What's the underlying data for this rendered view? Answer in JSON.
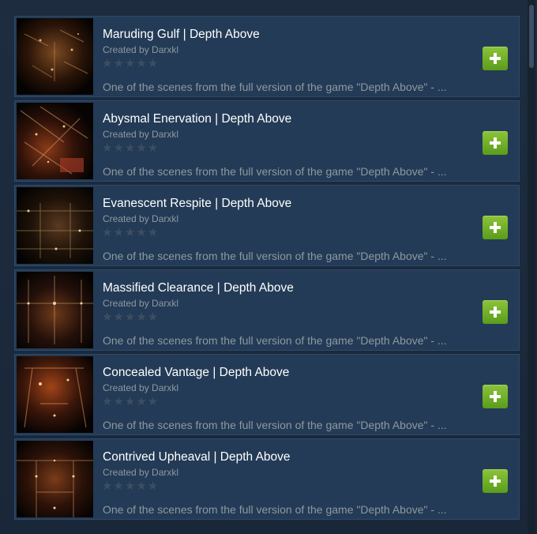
{
  "items": [
    {
      "title": "Maruding Gulf | Depth Above",
      "creator": "Created by Darxkl",
      "rating": "★★★★★",
      "description": "One of the scenes from the full version of the game \"Depth Above\" - ...",
      "thumb_icon": "scene-thumbnail-icon",
      "tint": "#6b3a1a"
    },
    {
      "title": "Abysmal Enervation | Depth Above",
      "creator": "Created by Darxkl",
      "rating": "★★★★★",
      "description": "One of the scenes from the full version of the game \"Depth Above\" - ...",
      "thumb_icon": "scene-thumbnail-icon",
      "tint": "#7a2f14"
    },
    {
      "title": "Evanescent Respite | Depth Above",
      "creator": "Created by Darxkl",
      "rating": "★★★★★",
      "description": "One of the scenes from the full version of the game \"Depth Above\" - ...",
      "thumb_icon": "scene-thumbnail-icon",
      "tint": "#4a2e18"
    },
    {
      "title": "Massified Clearance | Depth Above",
      "creator": "Created by Darxkl",
      "rating": "★★★★★",
      "description": "One of the scenes from the full version of the game \"Depth Above\" - ...",
      "thumb_icon": "scene-thumbnail-icon",
      "tint": "#5a2d12"
    },
    {
      "title": "Concealed Vantage | Depth Above",
      "creator": "Created by Darxkl",
      "rating": "★★★★★",
      "description": "One of the scenes from the full version of the game \"Depth Above\" - ...",
      "thumb_icon": "scene-thumbnail-icon",
      "tint": "#8a3a14"
    },
    {
      "title": "Contrived Upheaval | Depth Above",
      "creator": "Created by Darxkl",
      "rating": "★★★★★",
      "description": "One of the scenes from the full version of the game \"Depth Above\" - ...",
      "thumb_icon": "scene-thumbnail-icon",
      "tint": "#6a3416"
    }
  ],
  "colors": {
    "background": "#1b2838",
    "item_bg": "#233b56",
    "title": "#ffffff",
    "meta": "#8f98a0",
    "add_button": "#79b52e"
  },
  "add_icon": "plus-icon"
}
